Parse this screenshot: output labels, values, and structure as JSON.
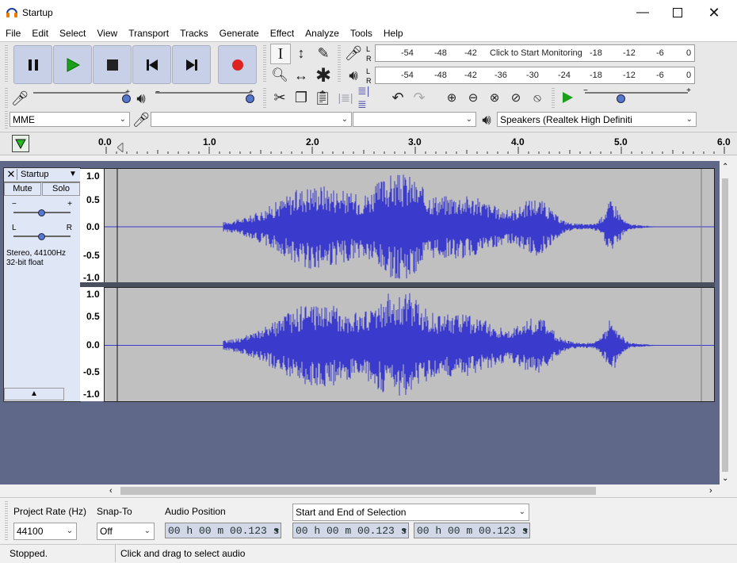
{
  "window": {
    "title": "Startup"
  },
  "menu": [
    "File",
    "Edit",
    "Select",
    "View",
    "Transport",
    "Tracks",
    "Generate",
    "Effect",
    "Analyze",
    "Tools",
    "Help"
  ],
  "meters": {
    "record_ticks": [
      "-54",
      "-48",
      "-42"
    ],
    "record_ticks_right": [
      "-18",
      "-12",
      "-6",
      "0"
    ],
    "record_hint": "Click to Start Monitoring",
    "play_ticks": [
      "-54",
      "-48",
      "-42",
      "-36",
      "-30",
      "-24",
      "-18",
      "-12",
      "-6",
      "0"
    ],
    "lr_top": "L",
    "lr_bottom": "R"
  },
  "devices": {
    "host": "MME",
    "recording_device": "",
    "channels": "",
    "playback_device": "Speakers (Realtek High Definiti"
  },
  "ruler": {
    "ticks": [
      "0.0",
      "1.0",
      "2.0",
      "3.0",
      "4.0",
      "5.0",
      "6.0"
    ]
  },
  "track": {
    "name": "Startup",
    "mute": "Mute",
    "solo": "Solo",
    "gain_minus": "−",
    "gain_plus": "+",
    "pan_left": "L",
    "pan_right": "R",
    "info_line1": "Stereo, 44100Hz",
    "info_line2": "32-bit float",
    "scale": [
      "1.0",
      "0.5",
      "0.0",
      "-0.5",
      "-1.0"
    ]
  },
  "selection_toolbar": {
    "project_rate_label": "Project Rate (Hz)",
    "project_rate_value": "44100",
    "snap_label": "Snap-To",
    "snap_value": "Off",
    "audio_position_label": "Audio Position",
    "audio_position_value": "00 h 00 m 00.123 s",
    "selection_mode": "Start and End of Selection",
    "selection_start": "00 h 00 m 00.123 s",
    "selection_end": "00 h 00 m 00.123 s"
  },
  "status": {
    "state": "Stopped.",
    "hint": "Click and drag to select audio"
  },
  "colors": {
    "waveform": "#3a3acc",
    "track_bg": "#60688a",
    "record": "#dd2222",
    "play": "#1aa01a"
  }
}
